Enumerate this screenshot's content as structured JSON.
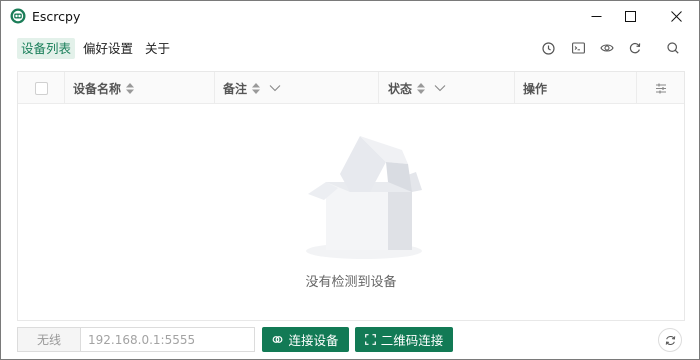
{
  "window": {
    "title": "Escrcpy"
  },
  "menu": {
    "items": [
      {
        "label": "设备列表",
        "active": true
      },
      {
        "label": "偏好设置",
        "active": false
      },
      {
        "label": "关于",
        "active": false
      }
    ]
  },
  "toolbar": {
    "icons": [
      "clock-icon",
      "terminal-icon",
      "eye-icon",
      "refresh-icon",
      "search-icon"
    ]
  },
  "table": {
    "columns": {
      "name": "设备名称",
      "remark": "备注",
      "status": "状态",
      "actions": "操作"
    },
    "empty_text": "没有检测到设备"
  },
  "bottom": {
    "mode_label": "无线",
    "ip_placeholder": "192.168.0.1:5555",
    "connect_label": "连接设备",
    "qr_label": "二维码连接"
  },
  "colors": {
    "accent": "#127a55",
    "active_menu_bg": "#e3f1ea"
  }
}
